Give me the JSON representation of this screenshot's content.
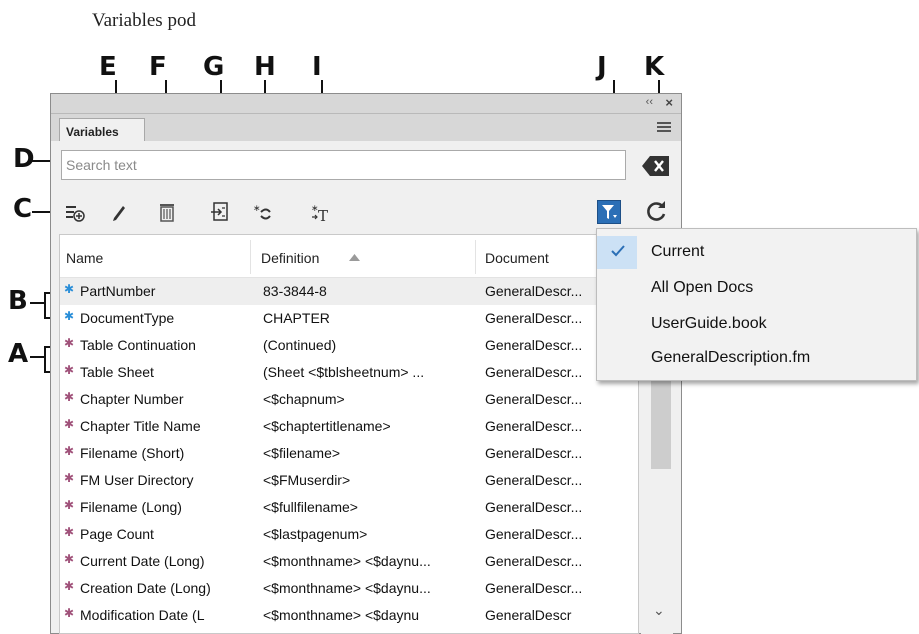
{
  "caption": "Variables pod",
  "callouts": [
    "A",
    "B",
    "C",
    "D",
    "E",
    "F",
    "G",
    "H",
    "I",
    "J",
    "K"
  ],
  "panel": {
    "tab": "Variables",
    "search_placeholder": "Search text"
  },
  "columns": [
    "Name",
    "Definition",
    "Document"
  ],
  "rows": [
    {
      "name": "PartNumber",
      "def": "83-3844-8",
      "doc": "GeneralDescr...",
      "kind": "user"
    },
    {
      "name": "DocumentType",
      "def": "CHAPTER",
      "doc": "GeneralDescr...",
      "kind": "user"
    },
    {
      "name": "Table Continuation",
      "def": "(Continued)",
      "doc": "GeneralDescr...",
      "kind": "system"
    },
    {
      "name": "Table Sheet",
      "def": "(Sheet <$tblsheetnum> ...",
      "doc": "GeneralDescr...",
      "kind": "system"
    },
    {
      "name": "Chapter Number",
      "def": "<$chapnum>",
      "doc": "GeneralDescr...",
      "kind": "system"
    },
    {
      "name": "Chapter Title Name",
      "def": "<$chaptertitlename>",
      "doc": "GeneralDescr...",
      "kind": "system"
    },
    {
      "name": "Filename (Short)",
      "def": "<$filename>",
      "doc": "GeneralDescr...",
      "kind": "system"
    },
    {
      "name": "FM User Directory",
      "def": "<$FMuserdir>",
      "doc": "GeneralDescr...",
      "kind": "system"
    },
    {
      "name": "Filename (Long)",
      "def": "<$fullfilename>",
      "doc": "GeneralDescr...",
      "kind": "system"
    },
    {
      "name": "Page Count",
      "def": "<$lastpagenum>",
      "doc": "GeneralDescr...",
      "kind": "system"
    },
    {
      "name": "Current Date (Long)",
      "def": "<$monthname> <$daynu...",
      "doc": "GeneralDescr...",
      "kind": "system"
    },
    {
      "name": "Creation Date (Long)",
      "def": "<$monthname> <$daynu...",
      "doc": "GeneralDescr...",
      "kind": "system"
    },
    {
      "name": "Modification Date (L",
      "def": "<$monthname> <$daynu",
      "doc": "GeneralDescr",
      "kind": "system"
    }
  ],
  "dropdown": [
    "Current",
    "All Open Docs",
    "UserGuide.book",
    "GeneralDescription.fm"
  ],
  "colors": {
    "user_icon": "#2a8ed8",
    "system_icon": "#a0527a",
    "filter_active": "#2b6fb6",
    "selected_row": "#eeeeee"
  }
}
